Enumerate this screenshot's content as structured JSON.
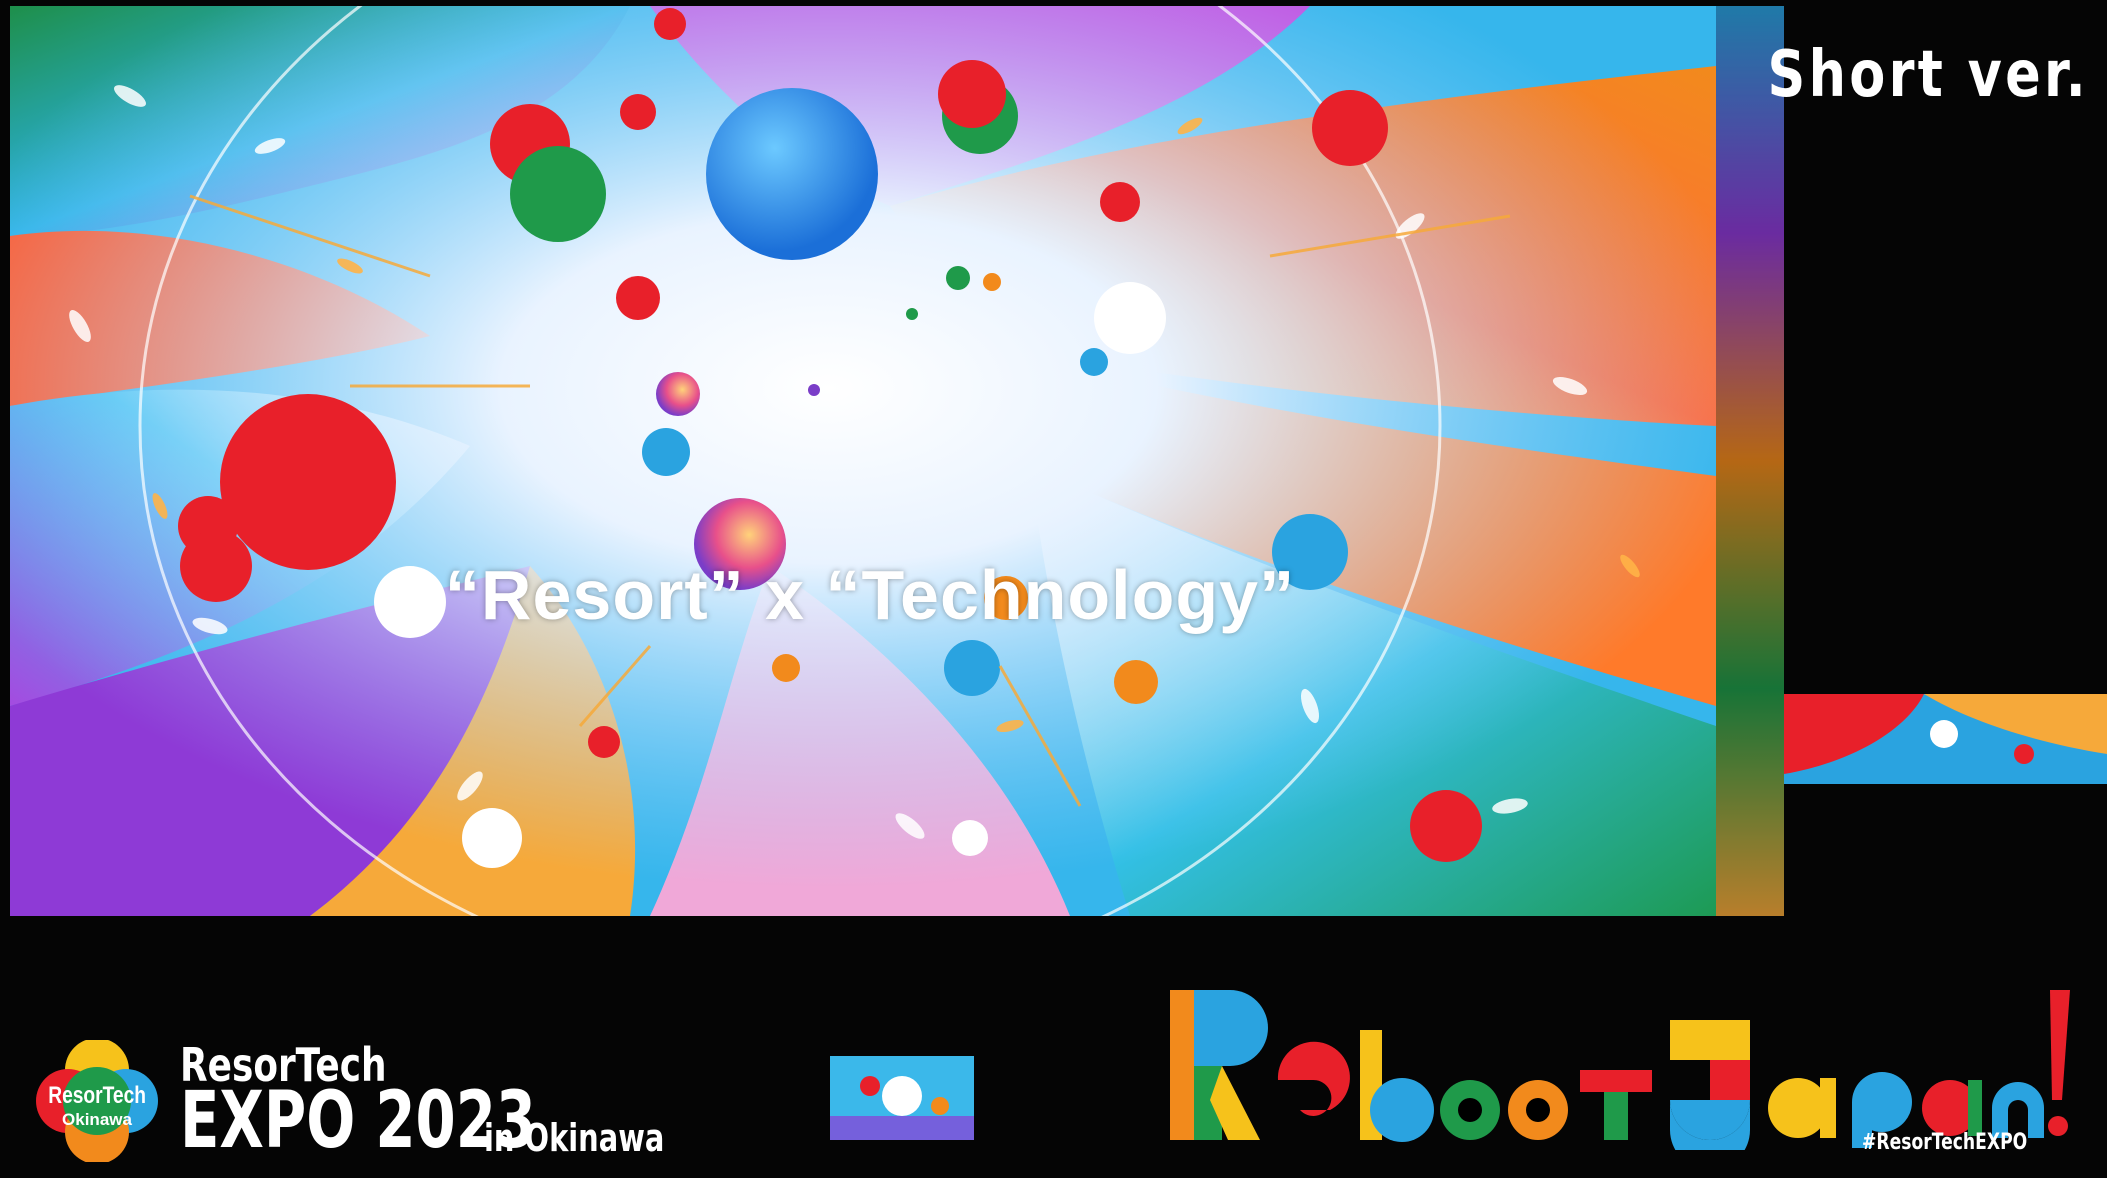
{
  "screen": {
    "caption": "“Resort” x “Technology”",
    "corner_label": "Short ver."
  },
  "branding": {
    "badge_line1": "ResorTech",
    "badge_line2": "Okinawa",
    "event_name": "ResorTech",
    "event_year": "EXPO 2023",
    "event_location": "in Okinawa",
    "slogan": "Reboot Japan!",
    "hashtag": "#ResorTechEXPO"
  },
  "colors": {
    "background": "#000000",
    "accent_red": "#e8202a",
    "accent_blue": "#2aa3e0",
    "accent_orange": "#f28a1c",
    "accent_green": "#1f9a4a",
    "accent_purple": "#8e3ad6",
    "accent_yellow": "#f6c21b"
  }
}
